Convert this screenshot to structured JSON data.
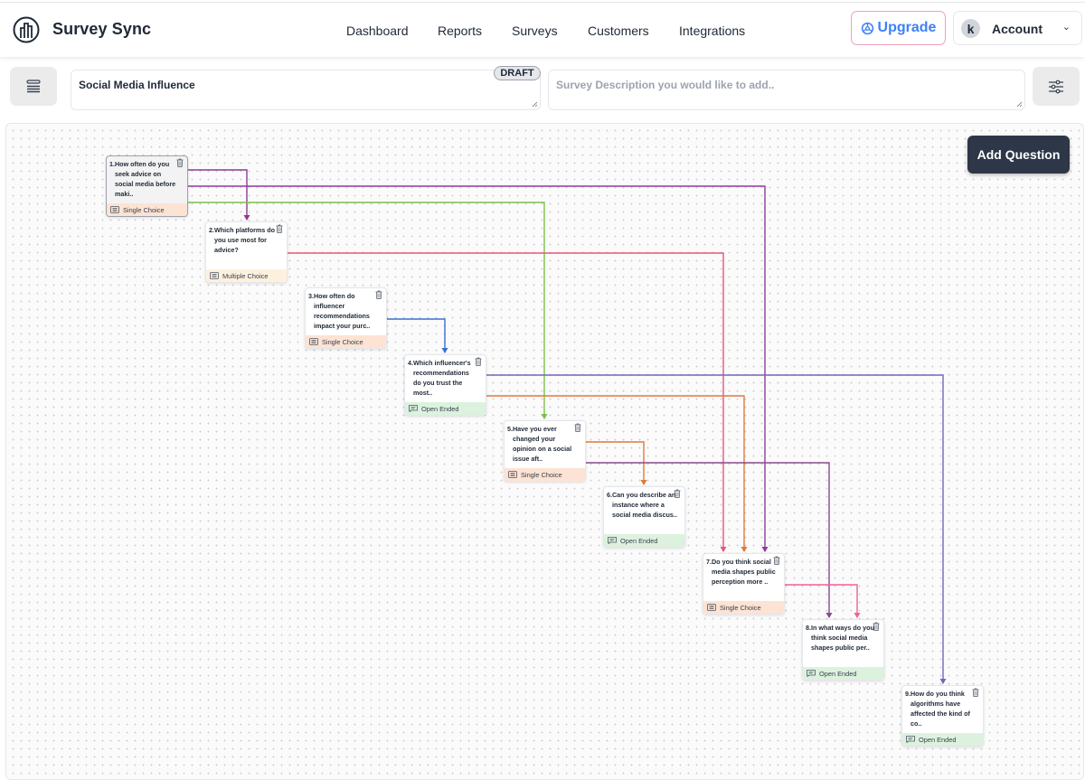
{
  "app": {
    "brand": "Survey Sync",
    "logo_icon": "chart-circle-icon"
  },
  "nav": {
    "items": [
      {
        "label": "Dashboard"
      },
      {
        "label": "Reports"
      },
      {
        "label": "Surveys"
      },
      {
        "label": "Customers"
      },
      {
        "label": "Integrations"
      }
    ],
    "upgrade_label": "Upgrade",
    "upgrade_icon": "gear-icon",
    "account_initial": "k",
    "account_label": "Account",
    "account_chevron": "chevron-down-icon"
  },
  "toolbar": {
    "menu_icon": "list-icon",
    "survey_title": "Social Media Influence",
    "status_badge": "DRAFT",
    "description_placeholder": "Survey Description you would like to add..",
    "description_value": "",
    "settings_icon": "sliders-icon"
  },
  "canvas": {
    "add_question_label": "Add Question",
    "colors": {
      "single_choice_bg": "#fde3d3",
      "multiple_choice_bg": "#fdf1de",
      "open_ended_bg": "#dcf2de",
      "add_question_bg": "#2d3748",
      "upgrade_text": "#3b82f6"
    },
    "questions": [
      {
        "number": 1,
        "text": "1.How often do you seek advice on social media before maki..",
        "type": "Single Choice",
        "selected": true
      },
      {
        "number": 2,
        "text": "2.Which platforms do you use most for advice?",
        "type": "Multiple Choice",
        "selected": false
      },
      {
        "number": 3,
        "text": "3.How often do influencer recommendations impact your purc..",
        "type": "Single Choice",
        "selected": false
      },
      {
        "number": 4,
        "text": "4.Which influencer's recommendations do you trust the most..",
        "type": "Open Ended",
        "selected": false
      },
      {
        "number": 5,
        "text": "5.Have you ever changed your opinion on a social issue aft..",
        "type": "Single Choice",
        "selected": false
      },
      {
        "number": 6,
        "text": "6.Can you describe an instance where a social media discus..",
        "type": "Open Ended",
        "selected": false
      },
      {
        "number": 7,
        "text": "7.Do you think social media shapes public perception more ..",
        "type": "Single Choice",
        "selected": false
      },
      {
        "number": 8,
        "text": "8.In what ways do you think social media shapes public per..",
        "type": "Open Ended",
        "selected": false
      },
      {
        "number": 9,
        "text": "9.How do you think algorithms have affected the kind of co..",
        "type": "Open Ended",
        "selected": false
      }
    ],
    "connections": [
      {
        "from": 1,
        "to": 2,
        "color": "#8e3a8e"
      },
      {
        "from": 1,
        "to": 7,
        "color": "#8e3a9e"
      },
      {
        "from": 1,
        "to": 5,
        "color": "#7cc04a"
      },
      {
        "from": 2,
        "to": 7,
        "color": "#e5587a"
      },
      {
        "from": 3,
        "to": 4,
        "color": "#3b6fd1"
      },
      {
        "from": 4,
        "to": 9,
        "color": "#7466b8"
      },
      {
        "from": 4,
        "to": 7,
        "color": "#e0793a"
      },
      {
        "from": 5,
        "to": 6,
        "color": "#e0793a"
      },
      {
        "from": 5,
        "to": 8,
        "color": "#8a4a8a"
      },
      {
        "from": 7,
        "to": 8,
        "color": "#f0609a"
      }
    ]
  }
}
